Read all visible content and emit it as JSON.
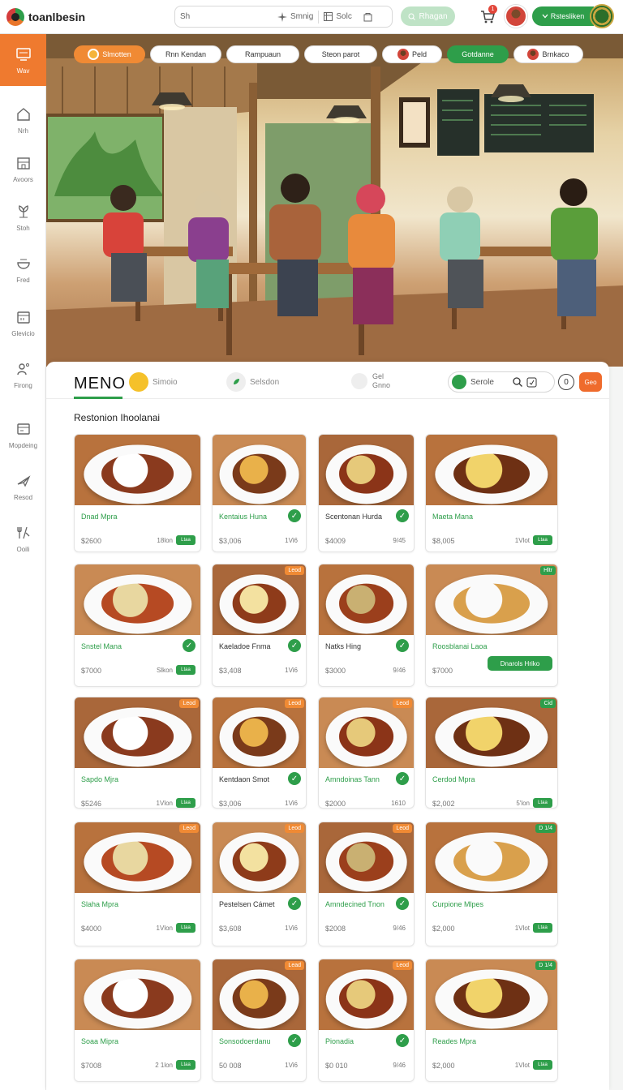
{
  "topbar": {
    "logo_text": "toanlbesin",
    "search_text": "Sh",
    "search_sort_label": "Smnig",
    "search_sel_label": "Solc",
    "ghost_button_label": "Rhagan",
    "cart_badge": "1",
    "green_button_label": "Rstesliken"
  },
  "sidebar": {
    "items": [
      {
        "label": "Wav",
        "icon": "monitor-icon"
      },
      {
        "label": "Nrh",
        "icon": "home-icon"
      },
      {
        "label": "Avoors",
        "icon": "store-icon"
      },
      {
        "label": "Stoh",
        "icon": "plant-icon"
      },
      {
        "label": "Fred",
        "icon": "bowl-icon"
      },
      {
        "label": "Glevicio",
        "icon": "calendar-icon"
      },
      {
        "label": "Firong",
        "icon": "person-icon"
      },
      {
        "label": "Mopdeing",
        "icon": "card-icon"
      },
      {
        "label": "Resod",
        "icon": "plane-icon"
      },
      {
        "label": "Ooili",
        "icon": "fork-icon"
      }
    ]
  },
  "hero": {
    "pills": [
      "Slmotten",
      "Rnn Kendan",
      "Rampuaun",
      "Steon parot",
      "Peld",
      "Gotdanne",
      "Brnkaco"
    ]
  },
  "menu": {
    "title": "MENO",
    "tab_a": "Simoio",
    "tab_b": "Selsdon",
    "tab_c_line1": "Gel",
    "tab_c_line2": "Gnno",
    "filter_label": "Serole",
    "round_button": "0",
    "orange_button": "Geo",
    "section_title": "Restonion Ihoolanai"
  },
  "cards": [
    {
      "name": "Dnad Mpra",
      "price": "$2600",
      "meta": "18lon",
      "tag": "",
      "check": false,
      "btn": "Ltaa",
      "name_color": "green"
    },
    {
      "name": "Kentaius Huna",
      "price": "$3,006",
      "meta": "1Vi6",
      "tag": "",
      "check": true,
      "btn": "",
      "name_color": "green"
    },
    {
      "name": "Scentonan Hurda",
      "price": "$4009",
      "meta": "9/45",
      "tag": "",
      "check": true,
      "btn": "",
      "name_color": "dark"
    },
    {
      "name": "Maeta Mana",
      "price": "$8,005",
      "meta": "1Vlot",
      "tag": "",
      "check": false,
      "btn": "Ltaa",
      "name_color": "green"
    },
    {
      "name": "Snstel Mana",
      "price": "$7000",
      "meta": "Slkon",
      "tag": "",
      "check": true,
      "btn": "Ltaa",
      "name_color": "green"
    },
    {
      "name": "Kaeladoe Fnma",
      "price": "$3,408",
      "meta": "1Vi6",
      "tag": "Leod",
      "check": true,
      "btn": "",
      "name_color": "dark"
    },
    {
      "name": "Natks Hing",
      "price": "$3000",
      "meta": "9/46",
      "tag": "",
      "check": true,
      "btn": "",
      "name_color": "dark"
    },
    {
      "name": "Roosblanai Laoa",
      "price": "$7000",
      "meta": "",
      "tag": "Hltr",
      "check": false,
      "btn": "Dnarols Hriko",
      "name_color": "green"
    },
    {
      "name": "Sapdo Mjra",
      "price": "$5246",
      "meta": "1Vlon",
      "tag": "Leod",
      "check": false,
      "btn": "Ltaa",
      "name_color": "green"
    },
    {
      "name": "Kentdaon Smot",
      "price": "$3,006",
      "meta": "1Vi6",
      "tag": "Leod",
      "check": true,
      "btn": "",
      "name_color": "dark"
    },
    {
      "name": "Amndoinas Tann",
      "price": "$2000",
      "meta": "1610",
      "tag": "Leod",
      "check": true,
      "btn": "",
      "name_color": "green"
    },
    {
      "name": "Cerdod Mpra",
      "price": "$2,002",
      "meta": "5'lon",
      "tag": "Cid",
      "check": false,
      "btn": "Ltaa",
      "name_color": "green"
    },
    {
      "name": "Slaha Mpra",
      "price": "$4000",
      "meta": "1Vlon",
      "tag": "Leod",
      "check": false,
      "btn": "Ltaa",
      "name_color": "green"
    },
    {
      "name": "Pestelsen Cámet",
      "price": "$3,608",
      "meta": "1Vi6",
      "tag": "Leod",
      "check": true,
      "btn": "",
      "name_color": "dark"
    },
    {
      "name": "Amndecined Tnon",
      "price": "$2008",
      "meta": "9/46",
      "tag": "Leod",
      "check": true,
      "btn": "",
      "name_color": "green"
    },
    {
      "name": "Curpione Mlpes",
      "price": "$2,000",
      "meta": "1Vlot",
      "tag": "D 1/4",
      "check": false,
      "btn": "Ltaa",
      "name_color": "green"
    },
    {
      "name": "Soaa Mipra",
      "price": "$7008",
      "meta": "2 1lon",
      "tag": "",
      "check": false,
      "btn": "Ltaa",
      "name_color": "green"
    },
    {
      "name": "Sonsodoerdanu",
      "price": "50 008",
      "meta": "1Vi6",
      "tag": "Lead",
      "check": true,
      "btn": "",
      "name_color": "green"
    },
    {
      "name": "Pionadia",
      "price": "$0 010",
      "meta": "9/46",
      "tag": "Leod",
      "check": true,
      "btn": "",
      "name_color": "green"
    },
    {
      "name": "Reades Mpra",
      "price": "$2,000",
      "meta": "1Vlot",
      "tag": "D 1/4",
      "check": false,
      "btn": "Ltaa",
      "name_color": "green"
    }
  ]
}
